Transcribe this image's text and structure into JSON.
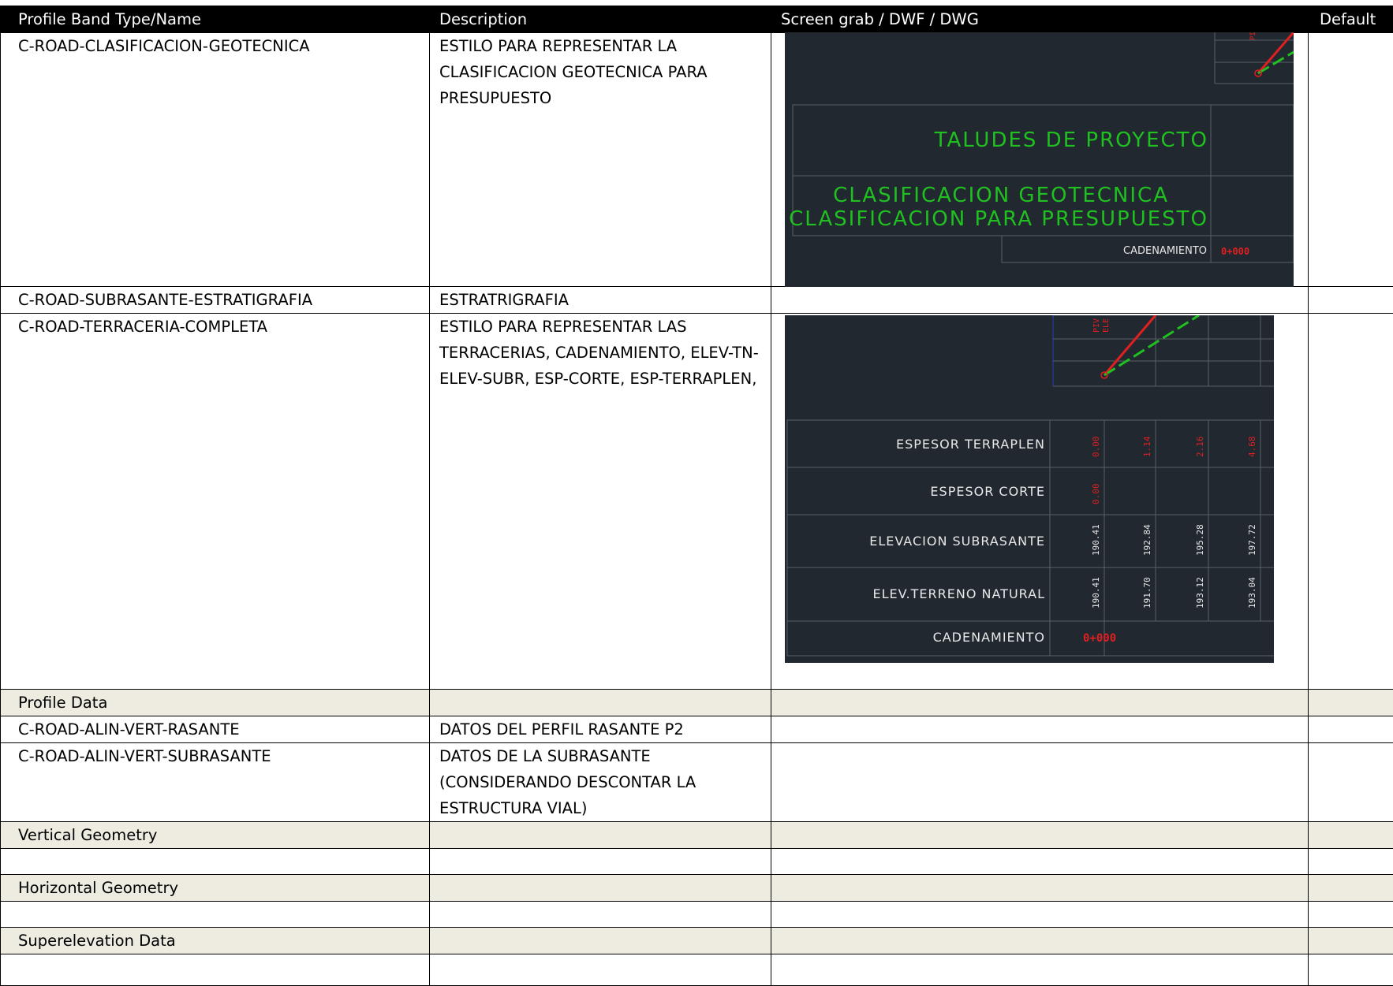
{
  "columns": {
    "name": "Profile Band Type/Name",
    "description": "Description",
    "screen": "Screen grab / DWF / DWG",
    "default": "Default"
  },
  "rows": [
    {
      "name": "C-ROAD-CLASIFICACION-GEOTECNICA",
      "description": "ESTILO PARA REPRESENTAR LA CLASIFICACION GEOTECNICA PARA PRESUPUESTO"
    },
    {
      "name": "C-ROAD-SUBRASANTE-ESTRATIGRAFIA",
      "description": "ESTRATRIGRAFIA"
    },
    {
      "name": "C-ROAD-TERRACERIA-COMPLETA",
      "description": "ESTILO PARA REPRESENTAR LAS TERRACERIAS, CADENAMIENTO, ELEV-TN-ELEV-SUBR, ESP-CORTE, ESP-TERRAPLEN,"
    },
    {
      "section": "Profile Data"
    },
    {
      "name": "C-ROAD-ALIN-VERT-RASANTE",
      "description": "DATOS DEL PERFIL RASANTE P2"
    },
    {
      "name": "C-ROAD-ALIN-VERT-SUBRASANTE",
      "description": "DATOS DE LA SUBRASANTE (CONSIDERANDO DESCONTAR LA ESTRUCTURA VIAL)"
    },
    {
      "section": "Vertical Geometry"
    },
    {
      "section": "Horizontal Geometry"
    },
    {
      "section": "Superelevation Data"
    }
  ],
  "cad1": {
    "labels": [
      "TALUDES DE PROYECTO",
      "CLASIFICACION GEOTECNICA",
      "CLASIFICACION PARA PRESUPUESTO",
      "CADENAMIENTO"
    ],
    "station": "0+000",
    "marker": "PI"
  },
  "cad2": {
    "labels": [
      "ESPESOR TERRAPLEN",
      "ESPESOR CORTE",
      "ELEVACION SUBRASANTE",
      "ELEV.TERRENO NATURAL",
      "CADENAMIENTO"
    ],
    "espesor_terraplen": [
      "0.00",
      "1.14",
      "2.16",
      "4.68"
    ],
    "espesor_corte": [
      "0.00"
    ],
    "elevacion_subrasante": [
      "190.41",
      "192.84",
      "195.28",
      "197.72"
    ],
    "elev_terreno_natural": [
      "190.41",
      "191.70",
      "193.12",
      "193.04"
    ],
    "station": "0+000",
    "marker_pi": "PIV",
    "marker_el": "ELE"
  },
  "colors": {
    "cad_bg": "#212830",
    "cad_green": "#20c020",
    "cad_red": "#e02020",
    "section_bg": "#eeece1"
  }
}
